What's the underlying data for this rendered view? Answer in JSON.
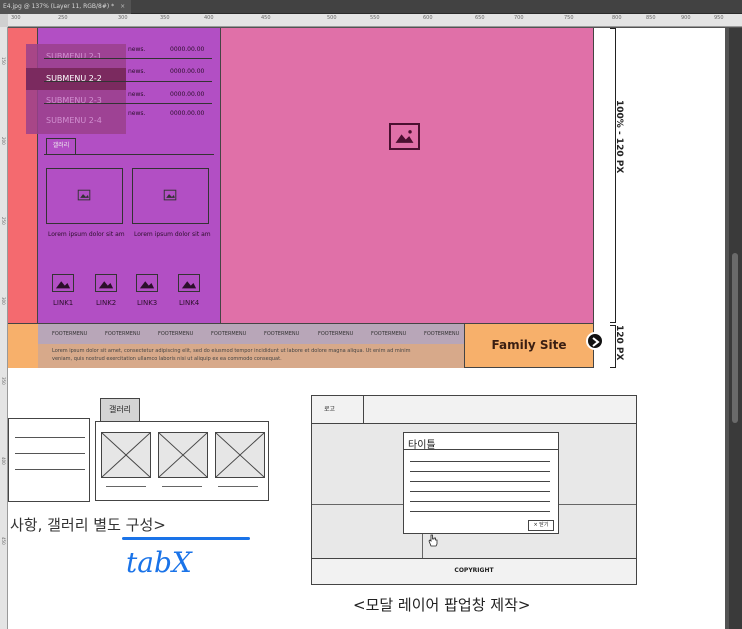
{
  "window": {
    "tab_title": "E4.jpg @ 137% (Layer 11, RGB/8#) *",
    "close": "×"
  },
  "ruler": {
    "top": [
      "300",
      "250",
      "300",
      "350",
      "400",
      "450",
      "500",
      "550",
      "600",
      "650",
      "700",
      "750",
      "800",
      "850",
      "900",
      "950"
    ],
    "left": [
      "150",
      "200",
      "250",
      "300",
      "350",
      "400",
      "450"
    ]
  },
  "wireframe": {
    "submenu": [
      "SUBMENU 2-1",
      "SUBMENU 2-2",
      "SUBMENU 2-3",
      "SUBMENU 2-4"
    ],
    "news": [
      {
        "title": "news.",
        "date": "0000.00.00"
      },
      {
        "title": "news.",
        "date": "0000.00.00"
      },
      {
        "title": "news.",
        "date": "0000.00.00"
      },
      {
        "title": "news.",
        "date": "0000.00.00"
      }
    ],
    "gallery_tab": "갤러리",
    "gallery_captions": [
      "Lorem ipsum dolor sit am",
      "Lorem ipsum dolor sit am"
    ],
    "links": [
      "LINK1",
      "LINK2",
      "LINK3",
      "LINK4"
    ],
    "footer_menu": [
      "FOOTERMENU",
      "FOOTERMENU",
      "FOOTERMENU",
      "FOOTERMENU",
      "FOOTERMENU",
      "FOOTERMENU",
      "FOOTERMENU",
      "FOOTERMENU"
    ],
    "footer_text": [
      "Lorem ipsum dolor sit amet, consectetur adipiscing elit, sed do eiusmod tempor incididunt ut labore et dolore magna aliqua. Ut enim ad minim",
      "veniam, quis nostrud exercitation ullamco laboris nisi ut aliquip ex ea commodo consequat."
    ],
    "family_site": "Family Site",
    "height_top": "100% - 120 PX",
    "height_bottom": "120 PX"
  },
  "sketch": {
    "gallery_tab": "갤러리",
    "caption": "사항, 갤러리 별도 구성>",
    "note": "tabX",
    "modal_logo": "로고",
    "modal_title": "타이틀",
    "modal_close": "× 닫기",
    "copyright": "COPYRIGHT",
    "modal_caption": "<모달 레이어 팝업창 제작>"
  },
  "colors": {
    "red": "#f46a6f",
    "purple": "#b24fc4",
    "pink": "#e070a8",
    "orange": "#f7b06b",
    "sub": "#7b2a5f",
    "blue": "#1a73e8"
  }
}
